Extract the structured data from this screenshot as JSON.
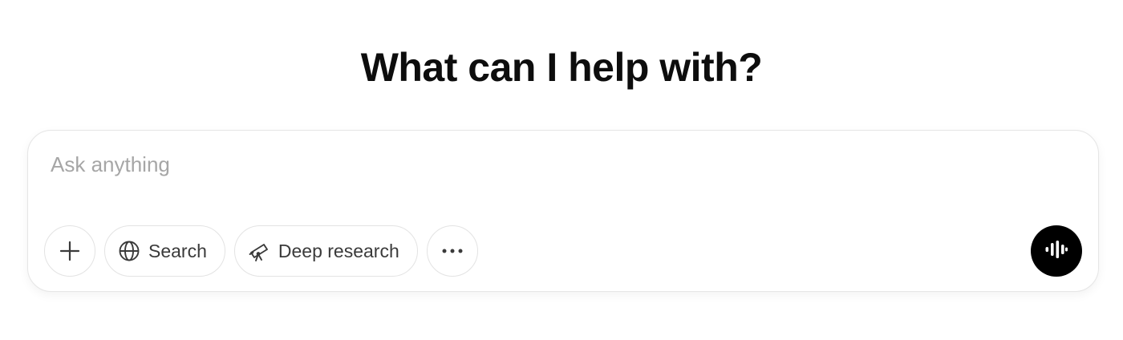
{
  "heading": "What can I help with?",
  "composer": {
    "placeholder": "Ask anything",
    "value": ""
  },
  "toolbar": {
    "attach_icon": "plus-icon",
    "search": {
      "label": "Search",
      "icon": "globe-icon"
    },
    "deep_research": {
      "label": "Deep research",
      "icon": "telescope-icon"
    },
    "more_icon": "ellipsis-icon"
  },
  "voice": {
    "icon": "voice-waveform-icon",
    "color": "#000000"
  },
  "colors": {
    "text": "#0d0d0d",
    "placeholder": "#a6a6a6",
    "border": "#e3e3e3",
    "accent": "#000000"
  }
}
